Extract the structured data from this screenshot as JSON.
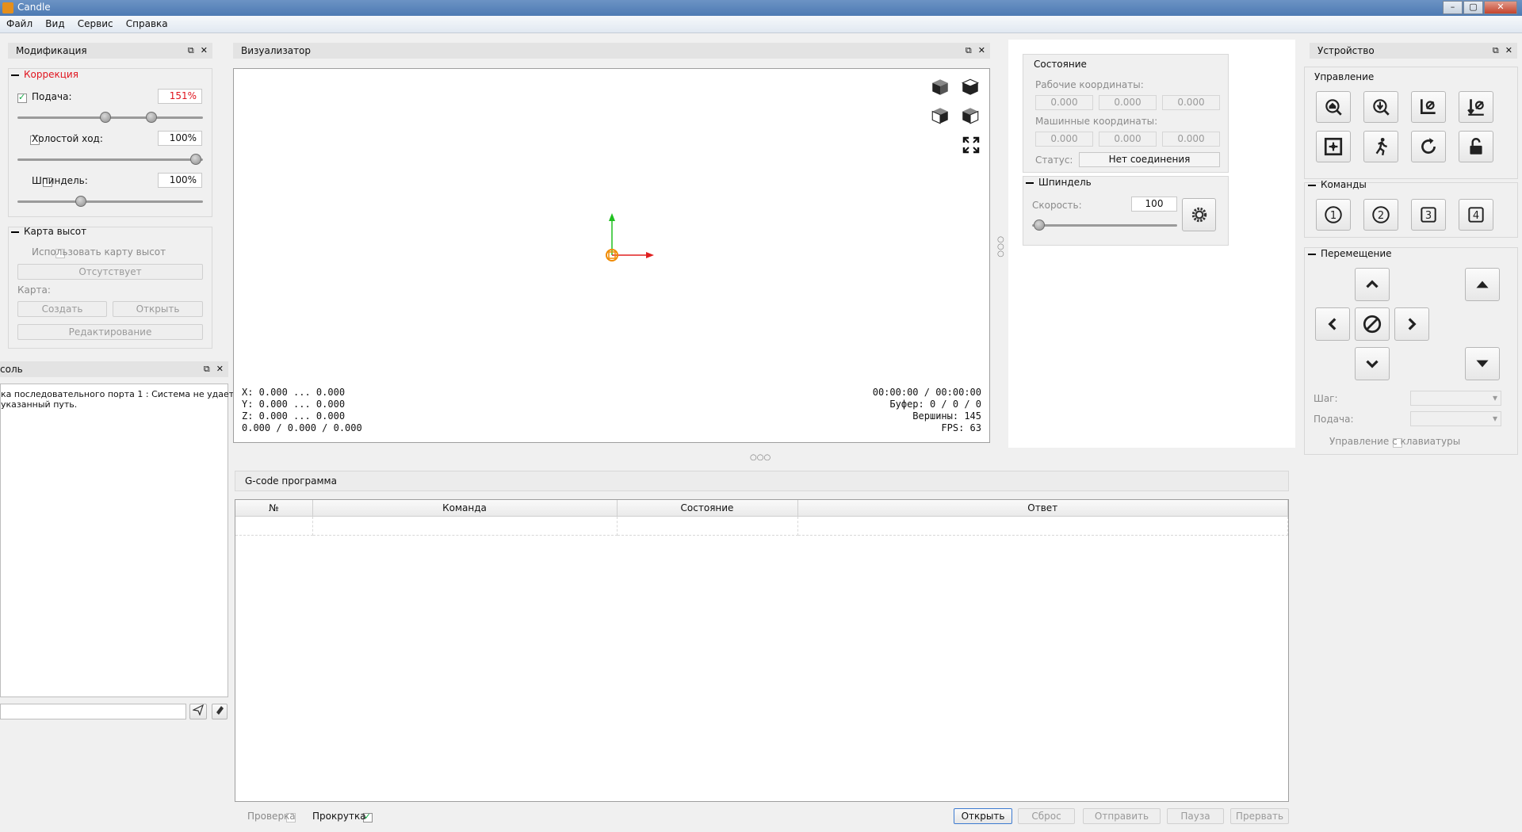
{
  "window": {
    "title": "Candle"
  },
  "menu": [
    "Файл",
    "Вид",
    "Сервис",
    "Справка"
  ],
  "modification": {
    "title": "Модификация",
    "correction": {
      "title": "Коррекция",
      "feed": {
        "label": "Подача:",
        "value": "151%",
        "checked": true
      },
      "rapid": {
        "label": "Холостой ход:",
        "value": "100%",
        "checked": false
      },
      "spindle": {
        "label": "Шпиндель:",
        "value": "100%",
        "checked": false
      }
    },
    "heightmap": {
      "title": "Карта высот",
      "use_label": "Использовать карту высот",
      "missing_button": "Отсутствует",
      "map_label": "Карта:",
      "create_button": "Создать",
      "open_button": "Открыть",
      "edit_button": "Редактирование"
    }
  },
  "console": {
    "title": "соль",
    "lines": [
      "ка последовательного порта 1 : Система не удается",
      "указанный путь."
    ]
  },
  "visualizer": {
    "title": "Визуализатор",
    "coords": [
      "X: 0.000 ... 0.000",
      "Y: 0.000 ... 0.000",
      "Z: 0.000 ... 0.000",
      "0.000 / 0.000 / 0.000"
    ],
    "stats": [
      "00:00:00 / 00:00:00",
      "Буфер: 0 / 0 / 0",
      "Вершины: 145",
      "FPS: 63"
    ]
  },
  "state": {
    "title": "Состояние",
    "work_coords_label": "Рабочие координаты:",
    "work_coords": [
      "0.000",
      "0.000",
      "0.000"
    ],
    "machine_coords_label": "Машинные координаты:",
    "machine_coords": [
      "0.000",
      "0.000",
      "0.000"
    ],
    "status_label": "Статус:",
    "status_value": "Нет соединения"
  },
  "spindle": {
    "title": "Шпиндель",
    "speed_label": "Скорость:",
    "speed_value": "100"
  },
  "device": {
    "title": "Устройство",
    "control_title": "Управление",
    "commands_title": "Команды",
    "commands": [
      "1",
      "2",
      "3",
      "4"
    ],
    "jog_title": "Перемещение",
    "step_label": "Шаг:",
    "feed_label": "Подача:",
    "keyboard_label": "Управление с клавиатуры"
  },
  "gcode": {
    "title": "G-code программа",
    "columns": [
      "№",
      "Команда",
      "Состояние",
      "Ответ"
    ],
    "check_label": "Проверка",
    "scroll_label": "Прокрутка",
    "buttons": {
      "open": "Открыть",
      "reset": "Сброс",
      "send": "Отправить",
      "pause": "Пауза",
      "abort": "Прервать"
    }
  },
  "colors": {
    "accent_red": "#e0141e",
    "axis_x": "#e02020",
    "axis_y": "#20c020",
    "origin": "#f08a00"
  }
}
